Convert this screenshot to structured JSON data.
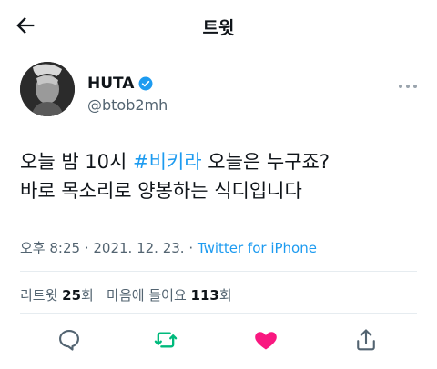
{
  "header": {
    "title": "트윗"
  },
  "tweet": {
    "author": {
      "name": "HUTA",
      "handle": "@btob2mh"
    },
    "text_line1_pre": "오늘 밤 10시 ",
    "hashtag": "#비키라",
    "text_line1_post": " 오늘은 누구죠?",
    "text_line2": "바로 목소리로 양봉하는 식디입니다",
    "meta": {
      "time": "오후 8:25",
      "sep1": " · ",
      "date": "2021. 12. 23.",
      "sep2": " · ",
      "source": "Twitter for iPhone"
    },
    "stats": {
      "retweets_label": "리트윗 ",
      "retweets_count": "25",
      "retweets_unit": "회",
      "likes_label": "마음에 들어요 ",
      "likes_count": "113",
      "likes_unit": "회"
    }
  },
  "actions": {
    "reply_icon": "speech-bubble-icon",
    "retweet_icon": "retweet-icon",
    "like_icon": "heart-icon",
    "share_icon": "share-icon"
  },
  "colors": {
    "accent": "#1d9bf0",
    "retweet_active": "#00ba7c",
    "like_active": "#f91880",
    "secondary_text": "#536471"
  }
}
